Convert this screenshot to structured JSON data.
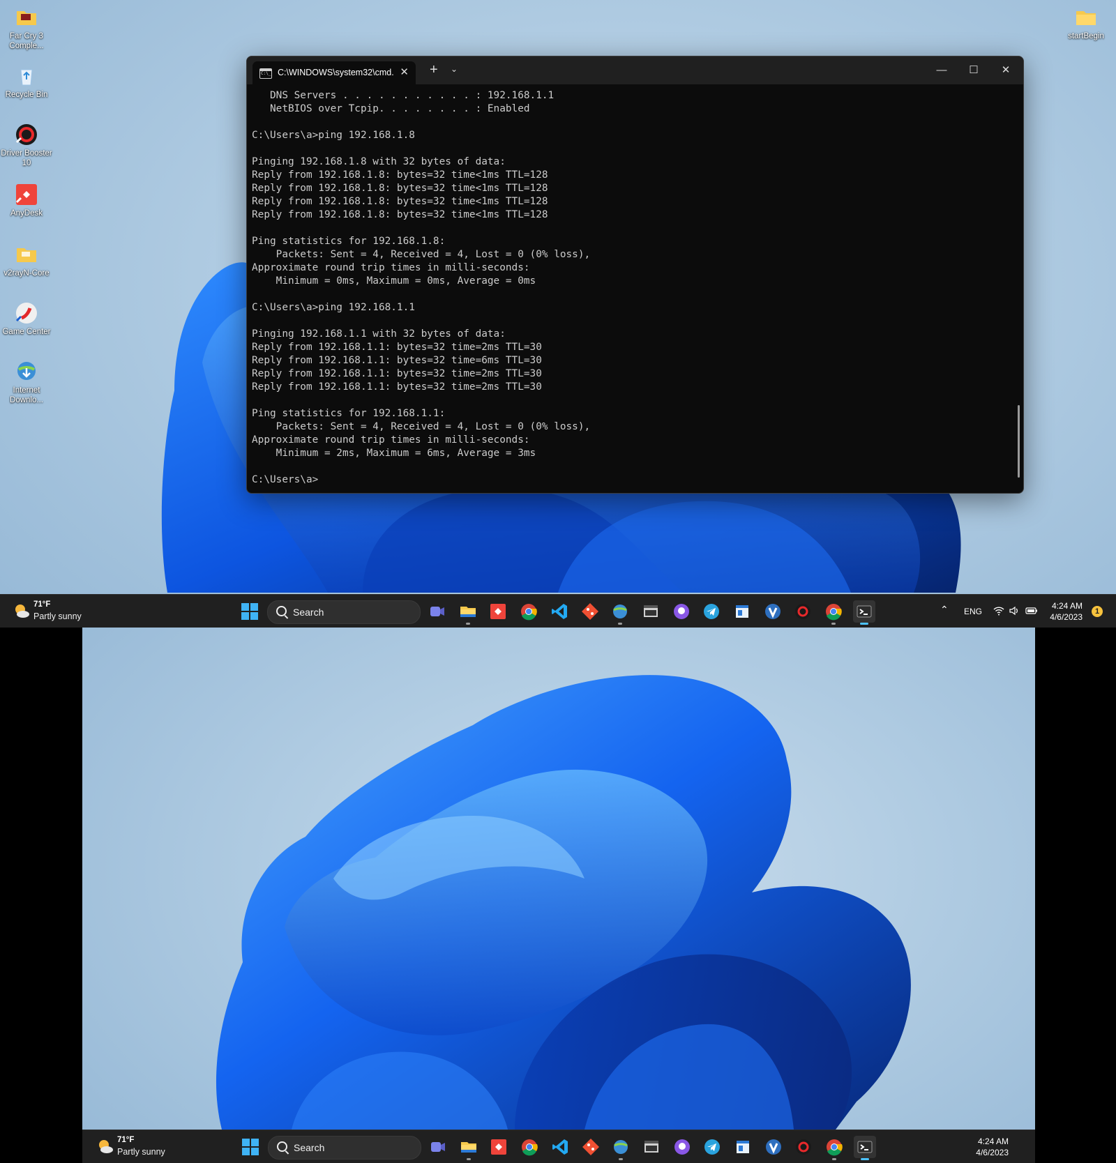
{
  "desktop_icons_left": [
    {
      "label": "Far Cry 3 Comple...",
      "icon": "folder-icon"
    },
    {
      "label": "Recycle Bin",
      "icon": "recycle-bin-icon"
    },
    {
      "label": "Driver Booster 10",
      "icon": "driver-booster-icon"
    },
    {
      "label": "AnyDesk",
      "icon": "anydesk-icon"
    },
    {
      "label": "v2rayN-Core",
      "icon": "folder-icon"
    },
    {
      "label": "Game Center",
      "icon": "game-center-icon"
    },
    {
      "label": "Internet Downlo...",
      "icon": "internet-download-manager-icon"
    }
  ],
  "desktop_icon_right": {
    "label": "startBegin",
    "icon": "folder-icon"
  },
  "terminal": {
    "tab_title": "C:\\WINDOWS\\system32\\cmd.",
    "new_tab": "+",
    "dropdown": "⌄",
    "minimize": "—",
    "maximize": "☐",
    "close": "✕",
    "lines": [
      "   DNS Servers . . . . . . . . . . . : 192.168.1.1",
      "   NetBIOS over Tcpip. . . . . . . . : Enabled",
      "",
      "C:\\Users\\a>ping 192.168.1.8",
      "",
      "Pinging 192.168.1.8 with 32 bytes of data:",
      "Reply from 192.168.1.8: bytes=32 time<1ms TTL=128",
      "Reply from 192.168.1.8: bytes=32 time<1ms TTL=128",
      "Reply from 192.168.1.8: bytes=32 time<1ms TTL=128",
      "Reply from 192.168.1.8: bytes=32 time<1ms TTL=128",
      "",
      "Ping statistics for 192.168.1.8:",
      "    Packets: Sent = 4, Received = 4, Lost = 0 (0% loss),",
      "Approximate round trip times in milli-seconds:",
      "    Minimum = 0ms, Maximum = 0ms, Average = 0ms",
      "",
      "C:\\Users\\a>ping 192.168.1.1",
      "",
      "Pinging 192.168.1.1 with 32 bytes of data:",
      "Reply from 192.168.1.1: bytes=32 time=2ms TTL=30",
      "Reply from 192.168.1.1: bytes=32 time=6ms TTL=30",
      "Reply from 192.168.1.1: bytes=32 time=2ms TTL=30",
      "Reply from 192.168.1.1: bytes=32 time=2ms TTL=30",
      "",
      "Ping statistics for 192.168.1.1:",
      "    Packets: Sent = 4, Received = 4, Lost = 0 (0% loss),",
      "Approximate round trip times in milli-seconds:",
      "    Minimum = 2ms, Maximum = 6ms, Average = 3ms",
      "",
      "C:\\Users\\a>"
    ]
  },
  "taskbar1": {
    "weather_temp": "71°F",
    "weather_cond": "Partly sunny",
    "search_label": "Search",
    "apps": [
      "meet-icon",
      "file-explorer-icon",
      "anydesk-icon",
      "chrome-icon",
      "vscode-icon",
      "git-icon",
      "idm-icon",
      "media-player-classic-icon",
      "github-icon",
      "telegram-icon",
      "notepad-icon",
      "v2ray-icon",
      "driver-booster-icon",
      "chrome-icon",
      "terminal-icon"
    ],
    "tray_lang": "ENG",
    "time": "4:24 AM",
    "date": "4/6/2023",
    "notification_count": "1"
  },
  "taskbar2": {
    "weather_temp": "71°F",
    "weather_cond": "Partly sunny",
    "search_label": "Search",
    "time": "4:24 AM",
    "date": "4/6/2023"
  },
  "colors": {
    "terminal_bg": "#0c0c0c",
    "terminal_text": "#cccccc",
    "taskbar_bg": "#202020",
    "accent": "#4cc2ff"
  }
}
